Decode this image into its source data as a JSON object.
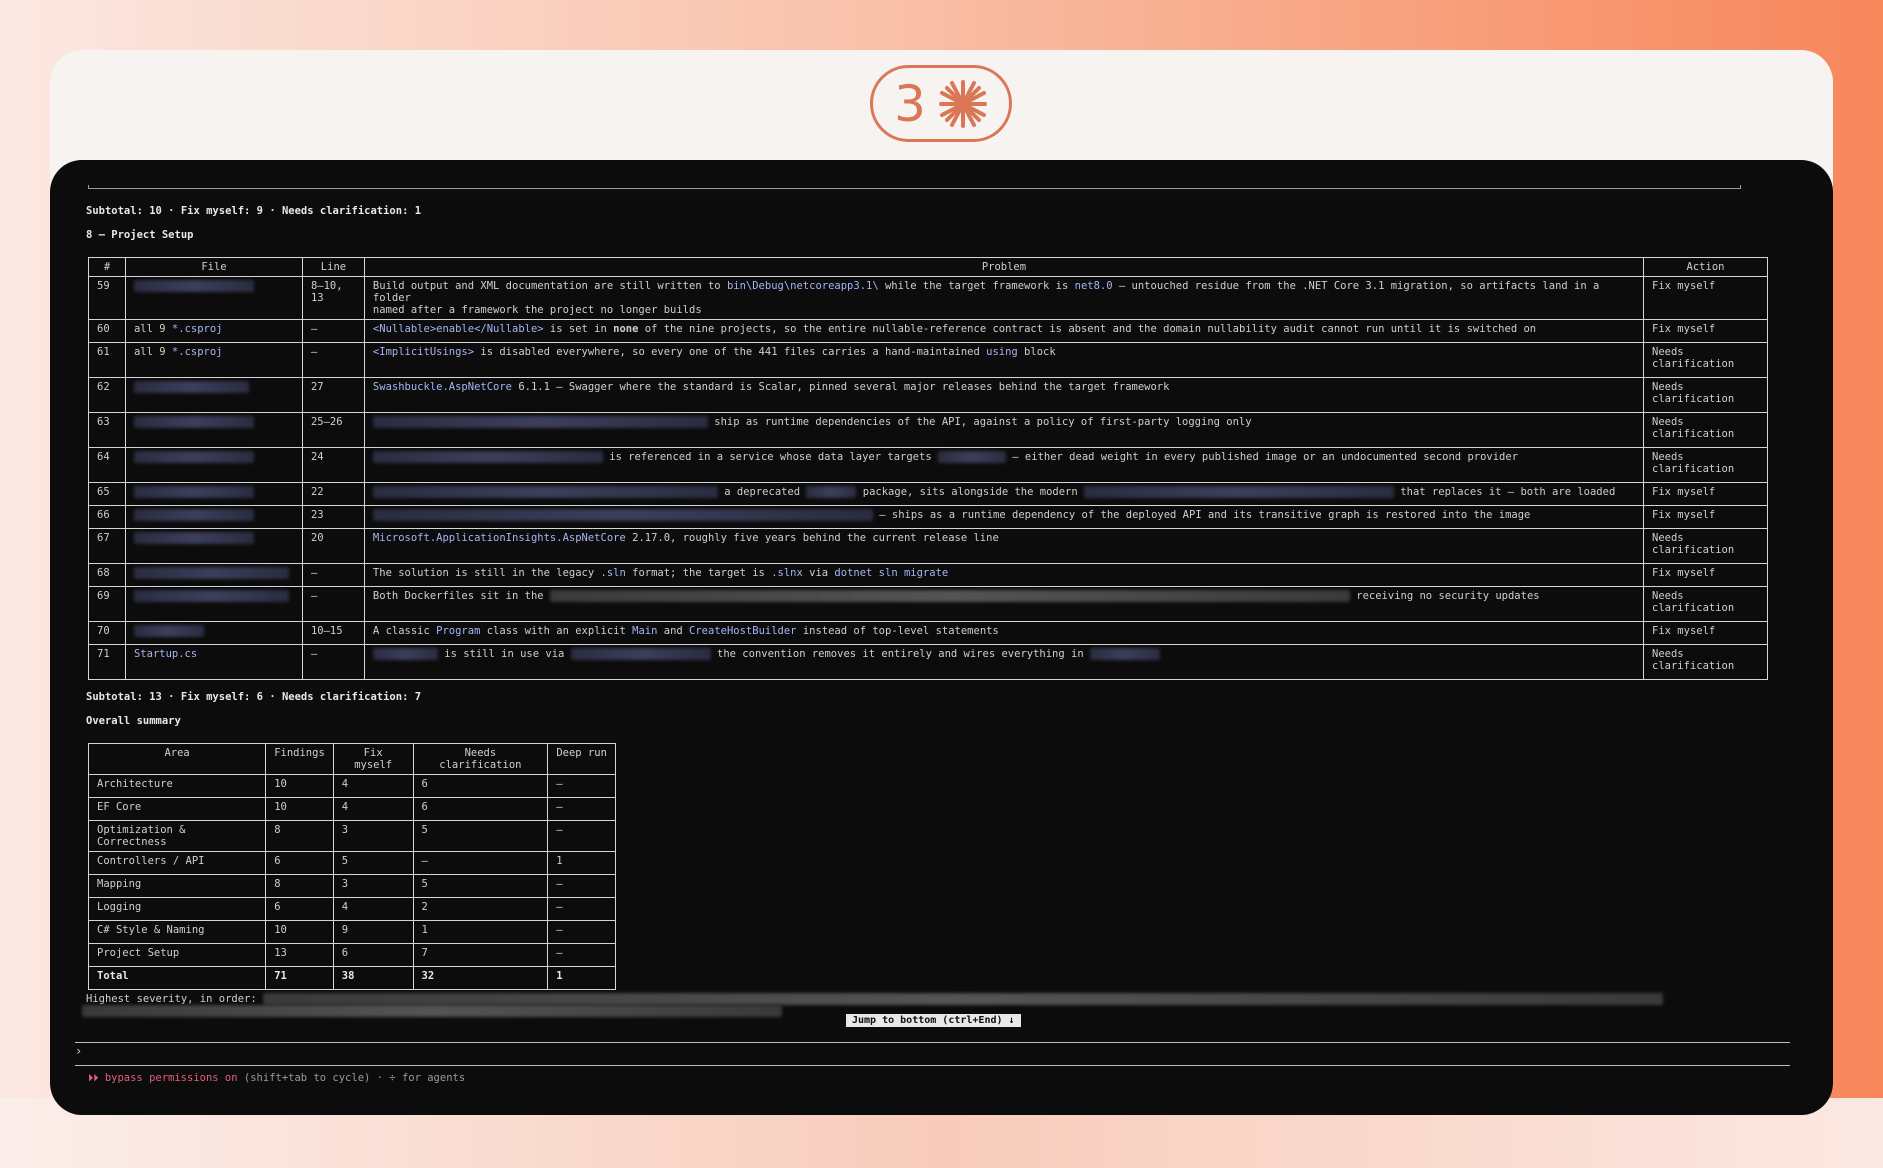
{
  "badge": {
    "number": "3",
    "icon": "asterisk-burst-icon",
    "accent": "#d97757"
  },
  "section7": {
    "subtotal": "Subtotal: 10 · Fix myself: 9 · Needs clarification: 1"
  },
  "section8": {
    "heading": "8 — Project Setup",
    "columns": [
      "#",
      "File",
      "Line",
      "Problem",
      "Action"
    ],
    "subtotal": "Subtotal: 13 · Fix myself: 6 · Needs clarification: 7",
    "rows": [
      {
        "num": "59",
        "line": "8–10,\n13",
        "action": "Fix myself",
        "p1": "Build output and XML documentation are still written to ",
        "p1c": "bin\\Debug\\netcoreapp3.1\\",
        "p2": " while the target framework is ",
        "p2c": "net8.0",
        "p3": " — untouched residue from the .NET Core 3.1 migration, so artifacts land in a folder",
        "p4": "named after a framework the project no longer builds"
      },
      {
        "num": "60",
        "file": "all 9 ",
        "file_code": "*.csproj",
        "line": "—",
        "action": "Fix myself",
        "p1c": "<Nullable>enable</Nullable>",
        "p1": " is set in ",
        "p1b": "none",
        "p2": " of the nine projects, so the entire nullable-reference contract is absent and the domain nullability audit cannot run until it is switched on"
      },
      {
        "num": "61",
        "file": "all 9 ",
        "file_code": "*.csproj",
        "line": "—",
        "action": "Needs\nclarification",
        "p1c": "<ImplicitUsings>",
        "p1": " is disabled everywhere, so every one of the 441 files carries a hand-maintained ",
        "p2c": "using",
        "p2": " block"
      },
      {
        "num": "62",
        "line": "27",
        "action": "Needs\nclarification",
        "p1c": "Swashbuckle.AspNetCore",
        "p1": " 6.1.1 — Swagger where the standard is Scalar, pinned several major releases behind the target framework"
      },
      {
        "num": "63",
        "line": "25–26",
        "action": "Needs\nclarification",
        "p1": " ship as runtime dependencies of the API, against a policy of first-party logging only"
      },
      {
        "num": "64",
        "line": "24",
        "action": "Needs\nclarification",
        "p1": " is referenced in a service whose data layer targets ",
        "p2": " — either dead weight in every published image or an undocumented second provider"
      },
      {
        "num": "65",
        "line": "22",
        "action": "Fix myself",
        "p1": " a deprecated ",
        "p2": " package, sits alongside the modern ",
        "p3": " that replaces it — both are loaded"
      },
      {
        "num": "66",
        "line": "23",
        "action": "Fix myself",
        "p1": " — ships as a runtime dependency of the deployed API and its transitive graph is restored into the image"
      },
      {
        "num": "67",
        "line": "20",
        "action": "Needs\nclarification",
        "p1c": "Microsoft.ApplicationInsights.AspNetCore",
        "p1": " 2.17.0, roughly five years behind the current release line"
      },
      {
        "num": "68",
        "line": "—",
        "action": "Fix myself",
        "p1": "The solution is still in the legacy ",
        "p1c": ".sln",
        "p2": " format; the target is ",
        "p2c": ".slnx",
        "p3": " via ",
        "p3c": "dotnet sln migrate"
      },
      {
        "num": "69",
        "line": "—",
        "action": "Needs\nclarification",
        "p1": "Both Dockerfiles sit in the ",
        "p2": " receiving no security updates"
      },
      {
        "num": "70",
        "line": "10–15",
        "action": "Fix myself",
        "p1": "A classic ",
        "p1c": "Program",
        "p2": " class with an explicit ",
        "p2c": "Main",
        "p3": " and ",
        "p3c": "CreateHostBuilder",
        "p4": " instead of top-level statements"
      },
      {
        "num": "71",
        "file_code": "Startup.cs",
        "line": "—",
        "action": "Needs\nclarification",
        "p1": " is still in use via ",
        "p2": " the convention removes it entirely and wires everything in "
      }
    ]
  },
  "summary": {
    "heading": "Overall summary",
    "columns": [
      "Area",
      "Findings",
      "Fix myself",
      "Needs clarification",
      "Deep run"
    ],
    "rows": [
      [
        "Architecture",
        "10",
        "4",
        "6",
        "—"
      ],
      [
        "EF Core",
        "10",
        "4",
        "6",
        "—"
      ],
      [
        "Optimization & Correctness",
        "8",
        "3",
        "5",
        "—"
      ],
      [
        "Controllers / API",
        "6",
        "5",
        "—",
        "1"
      ],
      [
        "Mapping",
        "8",
        "3",
        "5",
        "—"
      ],
      [
        "Logging",
        "6",
        "4",
        "2",
        "—"
      ],
      [
        "C# Style & Naming",
        "10",
        "9",
        "1",
        "—"
      ],
      [
        "Project Setup",
        "13",
        "6",
        "7",
        "—"
      ]
    ],
    "total": [
      "Total",
      "71",
      "38",
      "32",
      "1"
    ]
  },
  "severity_label": "Highest severity, in order:",
  "jump_button": "Jump to bottom (ctrl+End) ↓",
  "prompt_char": "›",
  "status": {
    "arrows": "⏵⏵",
    "mode": "bypass permissions on",
    "rest": " (shift+tab to cycle) · ÷ for agents"
  }
}
